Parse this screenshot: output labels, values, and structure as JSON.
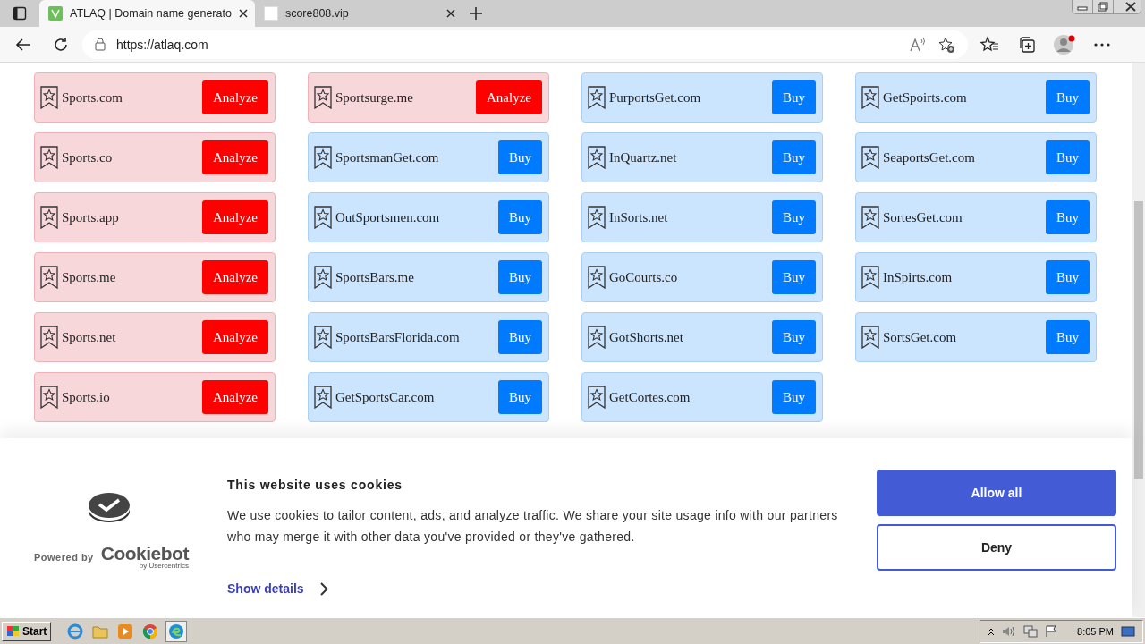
{
  "browser": {
    "tabs": [
      {
        "title": "ATLAQ | Domain name generato",
        "selected": true
      },
      {
        "title": "score808.vip",
        "selected": false
      }
    ],
    "url": "https://atlaq.com"
  },
  "domain_rows": [
    [
      {
        "domain": "Sports.com",
        "action": "Analyze",
        "kind": "analyze"
      },
      {
        "domain": "Sportsurge.me",
        "action": "Analyze",
        "kind": "analyze"
      },
      {
        "domain": "PurportsGet.com",
        "action": "Buy",
        "kind": "buy"
      },
      {
        "domain": "GetSpoirts.com",
        "action": "Buy",
        "kind": "buy"
      }
    ],
    [
      {
        "domain": "Sports.co",
        "action": "Analyze",
        "kind": "analyze"
      },
      {
        "domain": "SportsmanGet.com",
        "action": "Buy",
        "kind": "buy"
      },
      {
        "domain": "InQuartz.net",
        "action": "Buy",
        "kind": "buy"
      },
      {
        "domain": "SeaportsGet.com",
        "action": "Buy",
        "kind": "buy"
      }
    ],
    [
      {
        "domain": "Sports.app",
        "action": "Analyze",
        "kind": "analyze"
      },
      {
        "domain": "OutSportsmen.com",
        "action": "Buy",
        "kind": "buy"
      },
      {
        "domain": "InSorts.net",
        "action": "Buy",
        "kind": "buy"
      },
      {
        "domain": "SortesGet.com",
        "action": "Buy",
        "kind": "buy"
      }
    ],
    [
      {
        "domain": "Sports.me",
        "action": "Analyze",
        "kind": "analyze"
      },
      {
        "domain": "SportsBars.me",
        "action": "Buy",
        "kind": "buy"
      },
      {
        "domain": "GoCourts.co",
        "action": "Buy",
        "kind": "buy"
      },
      {
        "domain": "InSpirts.com",
        "action": "Buy",
        "kind": "buy"
      }
    ],
    [
      {
        "domain": "Sports.net",
        "action": "Analyze",
        "kind": "analyze"
      },
      {
        "domain": "SportsBarsFlorida.com",
        "action": "Buy",
        "kind": "buy"
      },
      {
        "domain": "GotShorts.net",
        "action": "Buy",
        "kind": "buy"
      },
      {
        "domain": "SortsGet.com",
        "action": "Buy",
        "kind": "buy"
      }
    ],
    [
      {
        "domain": "Sports.io",
        "action": "Analyze",
        "kind": "analyze"
      },
      {
        "domain": "GetSportsCar.com",
        "action": "Buy",
        "kind": "buy"
      },
      {
        "domain": "GetCortes.com",
        "action": "Buy",
        "kind": "buy"
      }
    ]
  ],
  "cookie_banner": {
    "title": "This website uses cookies",
    "text": "We use cookies to tailor content, ads, and analyze traffic. We share your site usage info with our partners who may merge it with other data you've provided or they've gathered.",
    "show_details": "Show details",
    "powered_by": "Powered by",
    "brand": "Cookiebot",
    "brand_sub": "by Usercentrics",
    "buttons": [
      "Allow all",
      "Deny"
    ]
  },
  "taskbar": {
    "start": "Start",
    "clock": "8:05 PM"
  }
}
